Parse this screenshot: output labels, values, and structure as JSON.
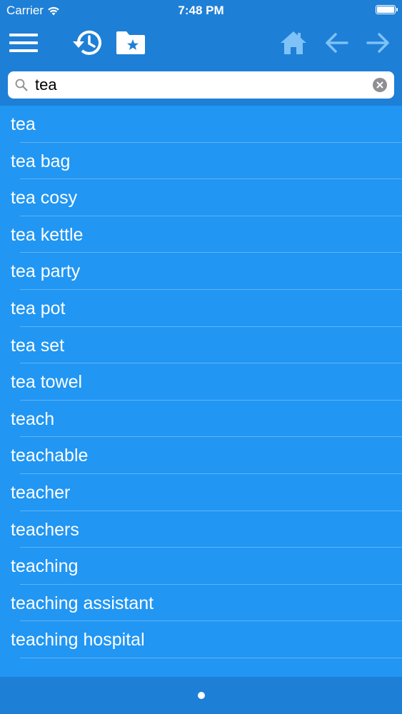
{
  "status_bar": {
    "carrier": "Carrier",
    "time": "7:48 PM",
    "battery_level": 1.0
  },
  "toolbar": {
    "menu_icon": "hamburger-menu-icon",
    "history_icon": "history-clock-icon",
    "favorites_icon": "folder-star-icon",
    "home_icon": "home-icon",
    "back_icon": "arrow-left-icon",
    "forward_icon": "arrow-right-icon"
  },
  "search": {
    "value": "tea",
    "placeholder": ""
  },
  "results": [
    {
      "label": "tea"
    },
    {
      "label": "tea bag"
    },
    {
      "label": "tea cosy"
    },
    {
      "label": "tea kettle"
    },
    {
      "label": "tea party"
    },
    {
      "label": "tea pot"
    },
    {
      "label": "tea set"
    },
    {
      "label": "tea towel"
    },
    {
      "label": "teach"
    },
    {
      "label": "teachable"
    },
    {
      "label": "teacher"
    },
    {
      "label": "teachers"
    },
    {
      "label": "teaching"
    },
    {
      "label": "teaching assistant"
    },
    {
      "label": "teaching hospital"
    }
  ],
  "pager": {
    "current_page": 1,
    "total_pages": 1
  },
  "colors": {
    "background": "#2196f3",
    "bar": "#1e7fd6",
    "separator": "#5fb4f7",
    "disabled_icon": "#7ec2f7"
  }
}
